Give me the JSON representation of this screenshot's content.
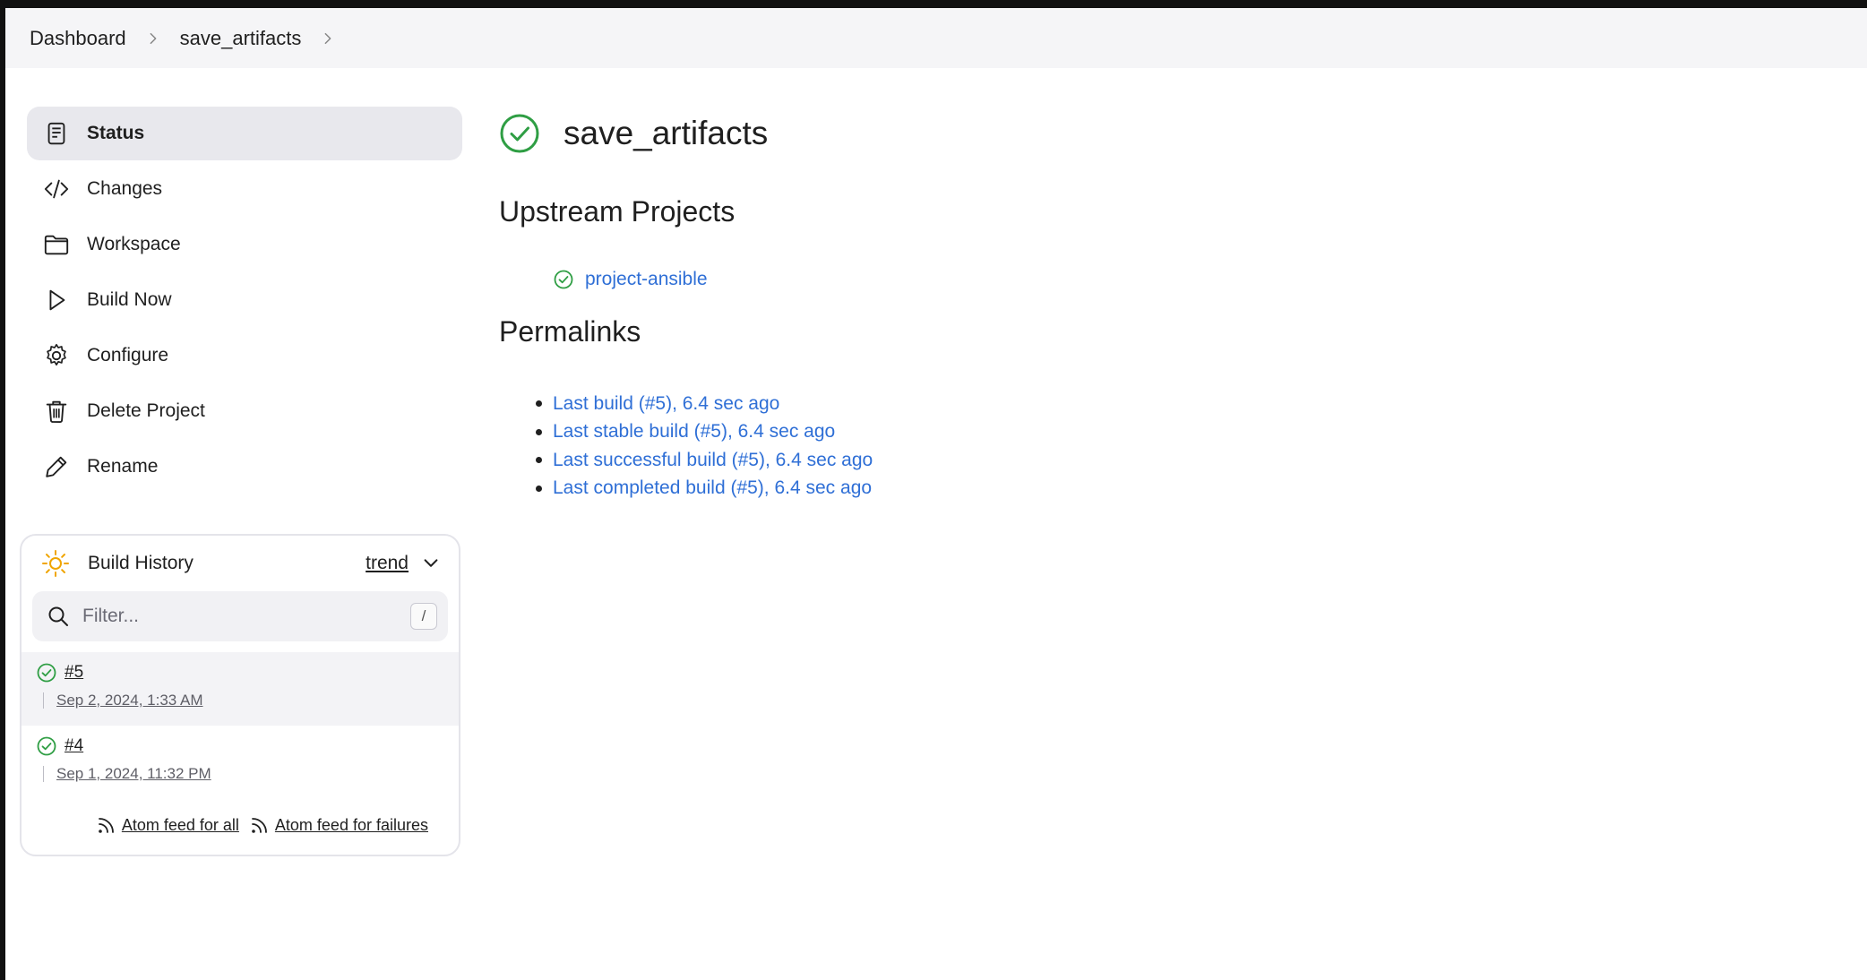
{
  "breadcrumb": {
    "items": [
      "Dashboard",
      "save_artifacts"
    ]
  },
  "sidebar": {
    "items": [
      {
        "label": "Status",
        "icon": "status-document-icon"
      },
      {
        "label": "Changes",
        "icon": "code-icon"
      },
      {
        "label": "Workspace",
        "icon": "folder-icon"
      },
      {
        "label": "Build Now",
        "icon": "play-icon"
      },
      {
        "label": "Configure",
        "icon": "gear-icon"
      },
      {
        "label": "Delete Project",
        "icon": "trash-icon"
      },
      {
        "label": "Rename",
        "icon": "pencil-icon"
      }
    ]
  },
  "build_history": {
    "title": "Build History",
    "trend_label": "trend",
    "filter_placeholder": "Filter...",
    "shortcut": "/",
    "builds": [
      {
        "number": "#5",
        "date": "Sep 2, 2024, 1:33 AM",
        "status": "success"
      },
      {
        "number": "#4",
        "date": "Sep 1, 2024, 11:32 PM",
        "status": "success"
      }
    ],
    "feeds": [
      "Atom feed for all",
      "Atom feed for failures"
    ]
  },
  "main": {
    "title": "save_artifacts",
    "upstream_heading": "Upstream Projects",
    "upstream_projects": [
      "project-ansible"
    ],
    "permalinks_heading": "Permalinks",
    "permalinks": [
      "Last build (#5), 6.4 sec ago",
      "Last stable build (#5), 6.4 sec ago",
      "Last successful build (#5), 6.4 sec ago",
      "Last completed build (#5), 6.4 sec ago"
    ]
  },
  "colors": {
    "success": "#2f9e44",
    "link": "#2f6fd6",
    "sun": "#f0a500"
  }
}
